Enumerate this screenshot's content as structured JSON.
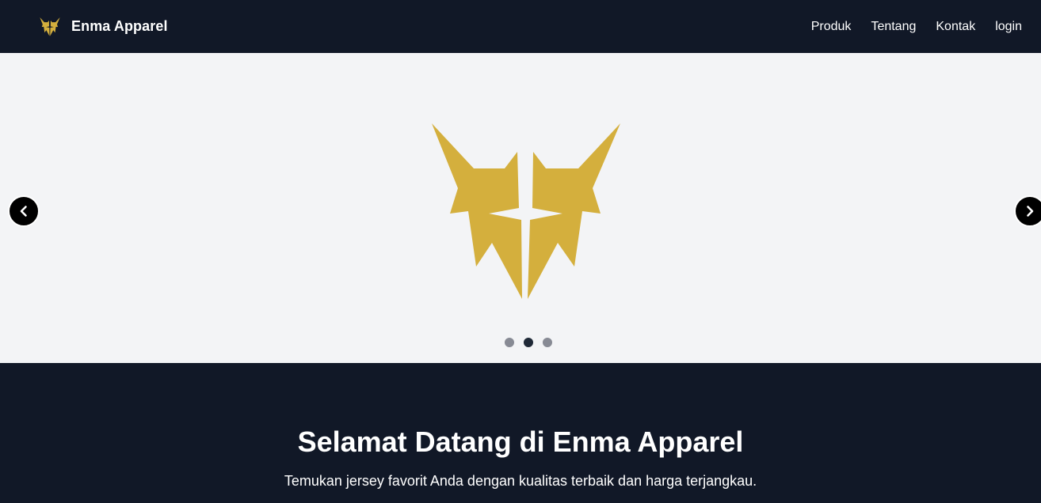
{
  "navbar": {
    "brand_name": "Enma Apparel",
    "logo_icon": "enma-mask-logo",
    "links": [
      {
        "label": "Produk"
      },
      {
        "label": "Tentang"
      },
      {
        "label": "Kontak"
      },
      {
        "label": "login"
      }
    ]
  },
  "carousel": {
    "slide_image": "enma-mask-logo",
    "prev_icon": "chevron-left-icon",
    "next_icon": "chevron-right-icon",
    "slide_count": 3,
    "active_slide": 2
  },
  "hero": {
    "title": "Selamat Datang di Enma Apparel",
    "subtitle": "Temukan jersey favorit Anda dengan kualitas terbaik dan harga terjangkau."
  },
  "colors": {
    "navbar_bg": "#111827",
    "logo_gold": "#d4af3d",
    "carousel_bg": "#f3f4f6",
    "dot_inactive": "#878a94",
    "dot_active": "#1f2937"
  }
}
